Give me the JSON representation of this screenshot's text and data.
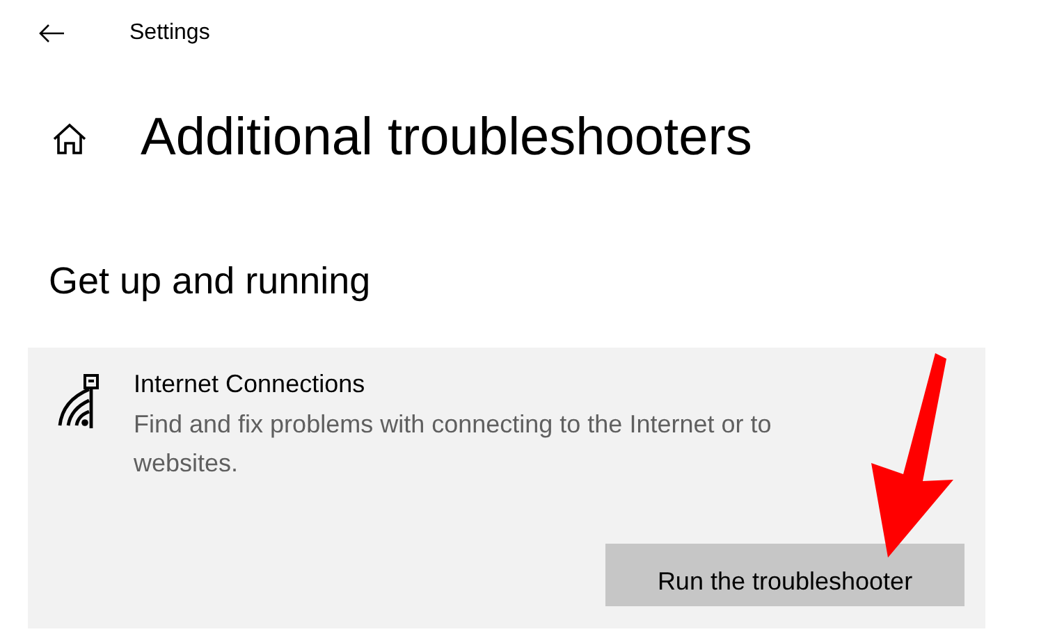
{
  "window": {
    "title": "Settings"
  },
  "page": {
    "title": "Additional troubleshooters"
  },
  "section": {
    "title": "Get up and running"
  },
  "troubleshooter": {
    "name": "Internet Connections",
    "description": "Find and fix problems with connecting to the Internet or to websites.",
    "button": "Run the troubleshooter"
  }
}
